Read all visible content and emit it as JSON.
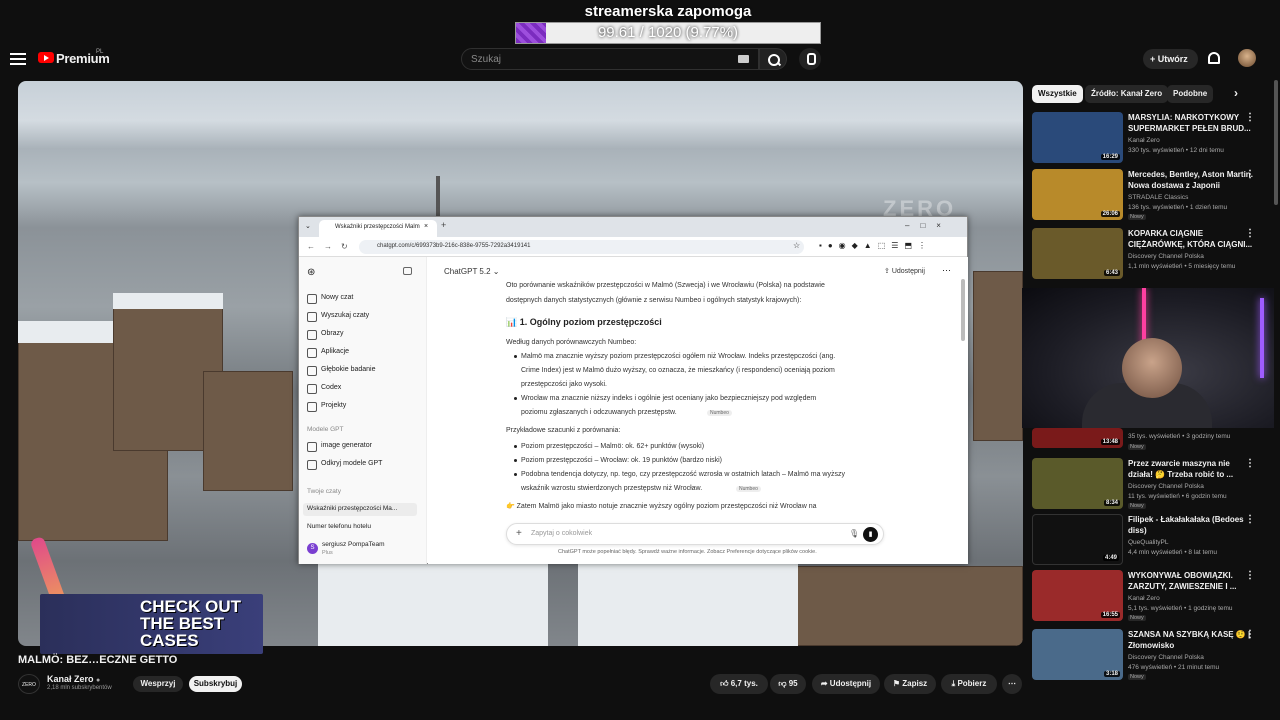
{
  "overlay": {
    "title": "streamerska zapomoga",
    "goal_text": "99.61 / 1020 (9.77%)",
    "goal_fraction": 0.0977
  },
  "topbar": {
    "brand": "Premium",
    "region": "PL",
    "search_placeholder": "Szukaj",
    "create_label": "Utwórz"
  },
  "browser": {
    "tab_title": "Wskaźniki przestępczości Malm",
    "url": "chatgpt.com/c/699373b9-216c-838e-9755-7292a3419141",
    "sidebar": {
      "items": [
        "Nowy czat",
        "Wyszukaj czaty",
        "Obrazy",
        "Aplikacje",
        "Głębokie badanie",
        "Codex",
        "Projekty"
      ],
      "gpt_header": "Modele GPT",
      "gpt_items": [
        "image generator",
        "Odkryj modele GPT"
      ],
      "chats_header": "Twoje czaty",
      "chats": [
        "Wskaźniki przestępczości Ma...",
        "Numer telefonu hotelu"
      ],
      "user_name": "sergiusz PompaTeam",
      "user_plan": "Plus",
      "user_initial": "S"
    },
    "main": {
      "model": "ChatGPT 5.2",
      "share": "Udostępnij",
      "intro_1": "Oto porównanie wskaźników przestępczości w Malmö (Szwecja) i we Wrocławiu (Polska) na podstawie",
      "intro_2": "dostępnych danych statystycznych (głównie z serwisu Numbeo i ogólnych statystyk krajowych):",
      "section_title": "📊 1. Ogólny poziom przestępczości",
      "lead": "Według danych porównawczych Numbeo:",
      "b1_1": "Malmö ma znacznie wyższy poziom przestępczości ogółem niż Wrocław. Indeks przestępczości (ang.",
      "b1_2": "Crime Index) jest w Malmö dużo wyższy, co oznacza, że mieszkańcy (i respondenci) oceniają poziom",
      "b1_3": "przestępczości jako wysoki.",
      "b2_1": "Wrocław ma znacznie niższy indeks i ogólnie jest oceniany jako bezpieczniejszy pod względem",
      "b2_2": "poziomu zgłaszanych i odczuwanych przestępstw.",
      "source": "Numbeo",
      "estimates": "Przykładowe szacunki z porównania:",
      "e1": "Poziom przestępczości – Malmö: ok. 62+ punktów (wysoki)",
      "e2": "Poziom przestępczości – Wrocław: ok. 19 punktów (bardzo niski)",
      "e3_1": "Podobna tendencja dotyczy, np. tego, czy przestępczość wzrosła w ostatnich latach – Malmö ma wyższy",
      "e3_2": "wskaźnik wzrostu stwierdzonych przestępstw niż Wrocław.",
      "conclusion": "👉 Zatem Malmö jako miasto notuje znacznie wyższy ogólny poziom przestępczości niż Wrocław na",
      "composer_placeholder": "Zapytaj o cokolwiek",
      "disclaimer": "ChatGPT może popełniać błędy. Sprawdź ważne informacje. Zobacz Preferencje dotyczące plików cookie."
    }
  },
  "video": {
    "watermark": "ZERO",
    "promo": "CHECK OUT THE BEST CASES",
    "title": "MALMÖ: BEZ…ECZNE GETTO",
    "channel": "Kanał Zero",
    "channel_logo": "ZERO",
    "subs": "2,18 mln subskrybentów",
    "support": "Wesprzyj",
    "subscribe": "Subskrybuj",
    "likes": "6,7 tys.",
    "dislikes": "95",
    "share": "Udostępnij",
    "save": "Zapisz",
    "download": "Pobierz"
  },
  "chips": [
    "Wszystkie",
    "Źródło: Kanał Zero",
    "Podobne"
  ],
  "recommendations": [
    {
      "title": "MARSYLIA: NARKOTYKOWY SUPERMARKET PEŁEN BRUD...",
      "channel": "Kanał Zero",
      "meta": "330 tys. wyświetleń • 12 dni temu",
      "duration": "16:29",
      "color": "#2a4a7a"
    },
    {
      "title": "Mercedes, Bentley, Aston Martin. Nowa dostawa z Japonii",
      "channel": "STRADALE Classics",
      "meta": "136 tys. wyświetleń • 1 dzień temu",
      "badge": "Nowy",
      "duration": "26:06",
      "color": "#b88a2a"
    },
    {
      "title": "KOPARKA CIĄGNIE CIĘŻARÓWKĘ, KTÓRA CIĄGNI...",
      "channel": "Discovery Channel Polska",
      "meta": "1,1 mln wyświetleń • 5 miesięcy temu",
      "duration": "6:43",
      "color": "#6a5a2a"
    },
    {
      "title": "",
      "channel": "",
      "meta": "35 tys. wyświetleń • 3 godziny temu",
      "badge": "Nowy",
      "duration": "13:48",
      "color": "#7a1a1a"
    },
    {
      "title": "Przez zwarcie maszyna nie działa! 🤔 Trzeba robić to ...",
      "channel": "Discovery Channel Polska",
      "meta": "11 tys. wyświetleń • 6 godzin temu",
      "badge": "Nowy",
      "duration": "8:34",
      "color": "#5a5a2a"
    },
    {
      "title": "Filipek - Łakałakałaka (Bedoes diss)",
      "channel": "QueQualityPL",
      "meta": "4,4 mln wyświetleń • 8 lat temu",
      "duration": "4:49",
      "color": "#111111"
    },
    {
      "title": "WYKONYWAŁ OBOWIĄZKI. ZARZUTY, ZAWIESZENIE I ...",
      "channel": "Kanał Zero",
      "meta": "5,1 tys. wyświetleń • 1 godzinę temu",
      "badge": "Nowy",
      "duration": "16:55",
      "color": "#9a2a2a"
    },
    {
      "title": "SZANSA NA SZYBKĄ KASĘ 🤨 | Złomowisko",
      "channel": "Discovery Channel Polska",
      "meta": "476 wyświetleń • 21 minut temu",
      "badge": "Nowy",
      "duration": "3:18",
      "color": "#4a6a8a"
    }
  ]
}
